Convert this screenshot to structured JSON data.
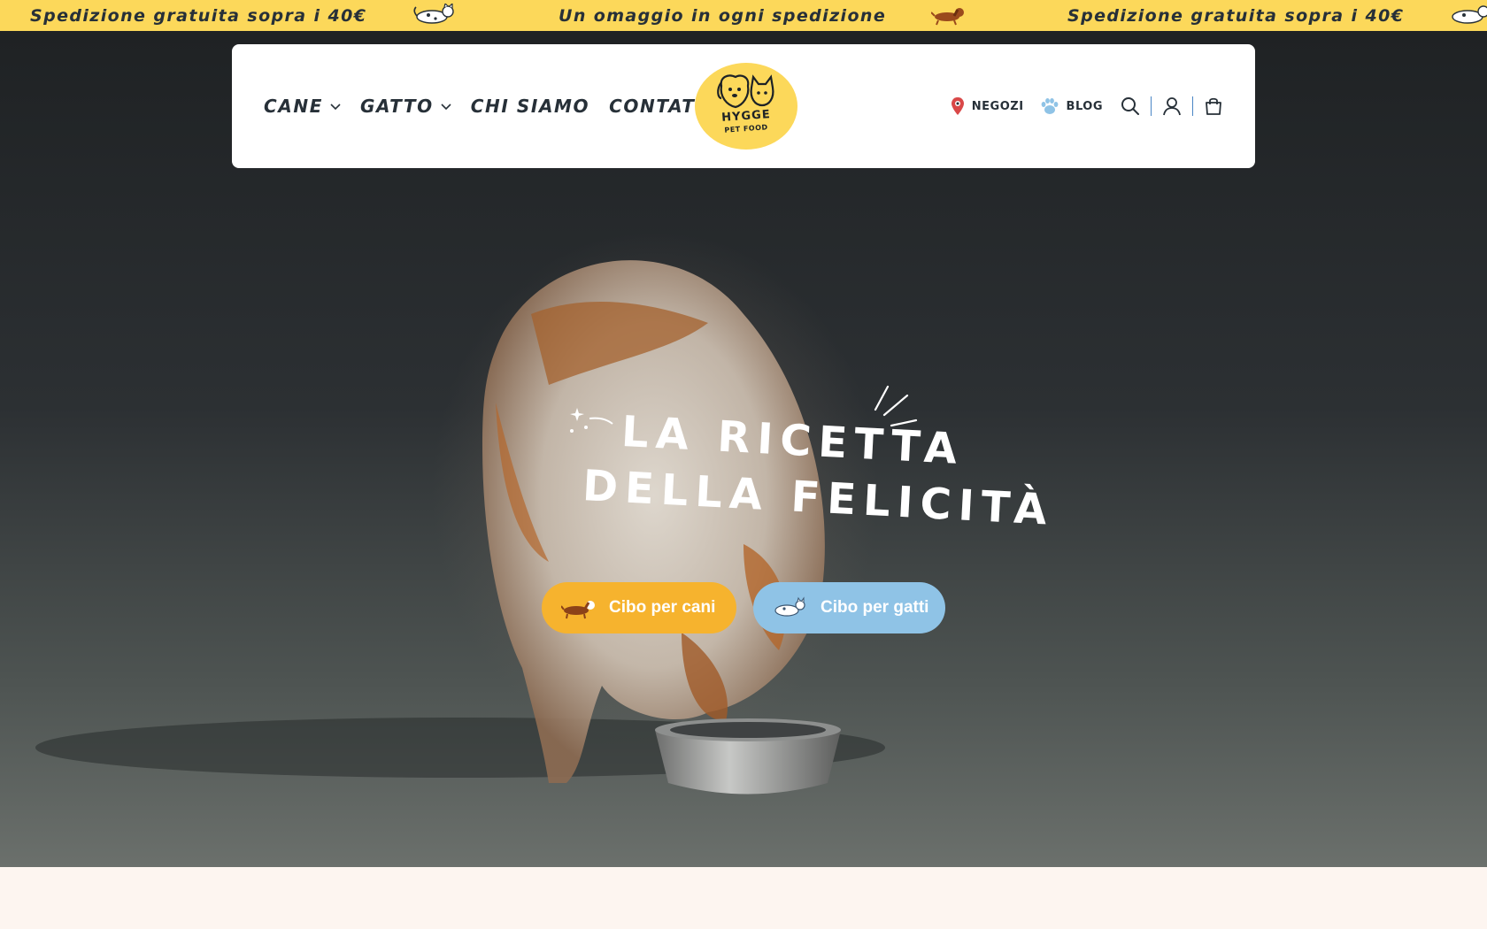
{
  "announcement": {
    "messages": [
      "Spedizione gratuita sopra i 40€",
      "Un omaggio in ogni spedizione",
      "Spedizione gratuita sopra i 40€"
    ],
    "background": "#fcd85a"
  },
  "header": {
    "nav": [
      {
        "label": "CANE",
        "dropdown": true
      },
      {
        "label": "GATTO",
        "dropdown": true
      },
      {
        "label": "CHI SIAMO",
        "dropdown": false
      },
      {
        "label": "CONTATTI",
        "dropdown": false
      }
    ],
    "logo": {
      "brand": "HYGGE",
      "sub": "PET FOOD"
    },
    "links": {
      "stores": "NEGOZI",
      "blog": "BLOG"
    },
    "icons": [
      "search-icon",
      "account-icon",
      "cart-icon"
    ]
  },
  "hero": {
    "headline_line1": "LA RICETTA",
    "headline_line2": "DELLA FELICITÀ",
    "cta_dog": "Cibo per cani",
    "cta_cat": "Cibo per gatti"
  },
  "colors": {
    "yellow": "#fcd85a",
    "orange": "#f6b32e",
    "blue": "#8fc3e6",
    "text": "#273038",
    "pin": "#d94848",
    "paw": "#8fc3e6"
  }
}
